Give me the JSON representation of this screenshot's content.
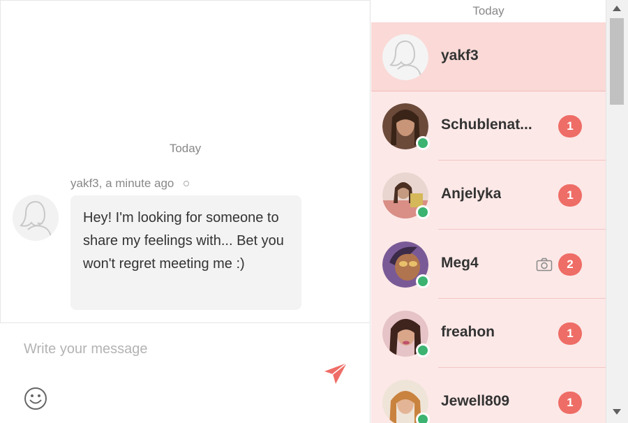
{
  "chat": {
    "day_separator": "Today",
    "message": {
      "author": "yakf3,",
      "time": "a minute ago",
      "text": "Hey! I'm looking for someone to share my feelings with... Bet you won't regret meeting me :)"
    },
    "composer": {
      "placeholder": "Write your message",
      "value": ""
    }
  },
  "sidebar": {
    "header": "Today",
    "conversations": [
      {
        "name": "yakf3",
        "unread": "",
        "online": false,
        "active": true,
        "photo": false
      },
      {
        "name": "Schublenat...",
        "unread": "1",
        "online": true,
        "active": false,
        "photo": false
      },
      {
        "name": "Anjelyka",
        "unread": "1",
        "online": true,
        "active": false,
        "photo": false
      },
      {
        "name": "Meg4",
        "unread": "2",
        "online": true,
        "active": false,
        "photo": true
      },
      {
        "name": "freahon",
        "unread": "1",
        "online": true,
        "active": false,
        "photo": false
      },
      {
        "name": "Jewell809",
        "unread": "1",
        "online": true,
        "active": false,
        "photo": false
      }
    ]
  },
  "colors": {
    "accent": "#ee6d66",
    "list_background": "#fce8e7",
    "active_row": "#fad9d7",
    "online": "#3cb371",
    "bubble": "#f3f3f3"
  },
  "icons": {
    "send": "send-icon",
    "emoji": "smiley-icon",
    "camera": "camera-icon",
    "placeholder_avatar": "female-silhouette-icon"
  }
}
